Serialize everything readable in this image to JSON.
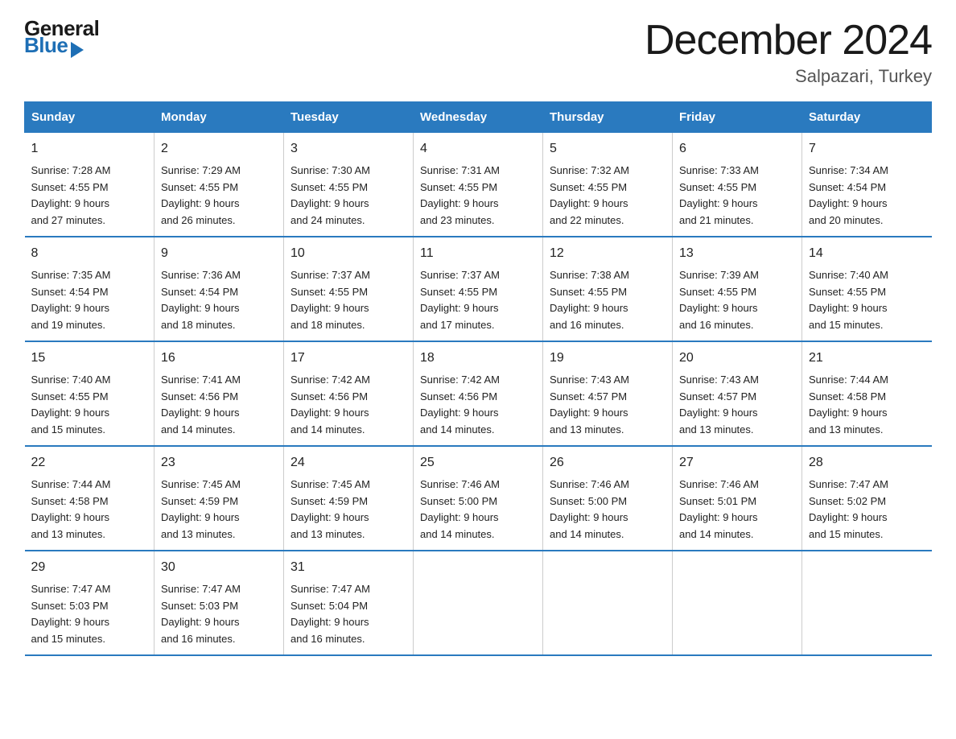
{
  "logo": {
    "general": "General",
    "blue": "Blue",
    "triangle": "▶"
  },
  "title": "December 2024",
  "subtitle": "Salpazari, Turkey",
  "days": [
    "Sunday",
    "Monday",
    "Tuesday",
    "Wednesday",
    "Thursday",
    "Friday",
    "Saturday"
  ],
  "weeks": [
    [
      {
        "date": "1",
        "sunrise": "7:28 AM",
        "sunset": "4:55 PM",
        "daylight": "9 hours and 27 minutes."
      },
      {
        "date": "2",
        "sunrise": "7:29 AM",
        "sunset": "4:55 PM",
        "daylight": "9 hours and 26 minutes."
      },
      {
        "date": "3",
        "sunrise": "7:30 AM",
        "sunset": "4:55 PM",
        "daylight": "9 hours and 24 minutes."
      },
      {
        "date": "4",
        "sunrise": "7:31 AM",
        "sunset": "4:55 PM",
        "daylight": "9 hours and 23 minutes."
      },
      {
        "date": "5",
        "sunrise": "7:32 AM",
        "sunset": "4:55 PM",
        "daylight": "9 hours and 22 minutes."
      },
      {
        "date": "6",
        "sunrise": "7:33 AM",
        "sunset": "4:55 PM",
        "daylight": "9 hours and 21 minutes."
      },
      {
        "date": "7",
        "sunrise": "7:34 AM",
        "sunset": "4:54 PM",
        "daylight": "9 hours and 20 minutes."
      }
    ],
    [
      {
        "date": "8",
        "sunrise": "7:35 AM",
        "sunset": "4:54 PM",
        "daylight": "9 hours and 19 minutes."
      },
      {
        "date": "9",
        "sunrise": "7:36 AM",
        "sunset": "4:54 PM",
        "daylight": "9 hours and 18 minutes."
      },
      {
        "date": "10",
        "sunrise": "7:37 AM",
        "sunset": "4:55 PM",
        "daylight": "9 hours and 18 minutes."
      },
      {
        "date": "11",
        "sunrise": "7:37 AM",
        "sunset": "4:55 PM",
        "daylight": "9 hours and 17 minutes."
      },
      {
        "date": "12",
        "sunrise": "7:38 AM",
        "sunset": "4:55 PM",
        "daylight": "9 hours and 16 minutes."
      },
      {
        "date": "13",
        "sunrise": "7:39 AM",
        "sunset": "4:55 PM",
        "daylight": "9 hours and 16 minutes."
      },
      {
        "date": "14",
        "sunrise": "7:40 AM",
        "sunset": "4:55 PM",
        "daylight": "9 hours and 15 minutes."
      }
    ],
    [
      {
        "date": "15",
        "sunrise": "7:40 AM",
        "sunset": "4:55 PM",
        "daylight": "9 hours and 15 minutes."
      },
      {
        "date": "16",
        "sunrise": "7:41 AM",
        "sunset": "4:56 PM",
        "daylight": "9 hours and 14 minutes."
      },
      {
        "date": "17",
        "sunrise": "7:42 AM",
        "sunset": "4:56 PM",
        "daylight": "9 hours and 14 minutes."
      },
      {
        "date": "18",
        "sunrise": "7:42 AM",
        "sunset": "4:56 PM",
        "daylight": "9 hours and 14 minutes."
      },
      {
        "date": "19",
        "sunrise": "7:43 AM",
        "sunset": "4:57 PM",
        "daylight": "9 hours and 13 minutes."
      },
      {
        "date": "20",
        "sunrise": "7:43 AM",
        "sunset": "4:57 PM",
        "daylight": "9 hours and 13 minutes."
      },
      {
        "date": "21",
        "sunrise": "7:44 AM",
        "sunset": "4:58 PM",
        "daylight": "9 hours and 13 minutes."
      }
    ],
    [
      {
        "date": "22",
        "sunrise": "7:44 AM",
        "sunset": "4:58 PM",
        "daylight": "9 hours and 13 minutes."
      },
      {
        "date": "23",
        "sunrise": "7:45 AM",
        "sunset": "4:59 PM",
        "daylight": "9 hours and 13 minutes."
      },
      {
        "date": "24",
        "sunrise": "7:45 AM",
        "sunset": "4:59 PM",
        "daylight": "9 hours and 13 minutes."
      },
      {
        "date": "25",
        "sunrise": "7:46 AM",
        "sunset": "5:00 PM",
        "daylight": "9 hours and 14 minutes."
      },
      {
        "date": "26",
        "sunrise": "7:46 AM",
        "sunset": "5:00 PM",
        "daylight": "9 hours and 14 minutes."
      },
      {
        "date": "27",
        "sunrise": "7:46 AM",
        "sunset": "5:01 PM",
        "daylight": "9 hours and 14 minutes."
      },
      {
        "date": "28",
        "sunrise": "7:47 AM",
        "sunset": "5:02 PM",
        "daylight": "9 hours and 15 minutes."
      }
    ],
    [
      {
        "date": "29",
        "sunrise": "7:47 AM",
        "sunset": "5:03 PM",
        "daylight": "9 hours and 15 minutes."
      },
      {
        "date": "30",
        "sunrise": "7:47 AM",
        "sunset": "5:03 PM",
        "daylight": "9 hours and 16 minutes."
      },
      {
        "date": "31",
        "sunrise": "7:47 AM",
        "sunset": "5:04 PM",
        "daylight": "9 hours and 16 minutes."
      },
      {
        "date": "",
        "sunrise": "",
        "sunset": "",
        "daylight": ""
      },
      {
        "date": "",
        "sunrise": "",
        "sunset": "",
        "daylight": ""
      },
      {
        "date": "",
        "sunrise": "",
        "sunset": "",
        "daylight": ""
      },
      {
        "date": "",
        "sunrise": "",
        "sunset": "",
        "daylight": ""
      }
    ]
  ],
  "labels": {
    "sunrise": "Sunrise:",
    "sunset": "Sunset:",
    "daylight": "Daylight:"
  }
}
